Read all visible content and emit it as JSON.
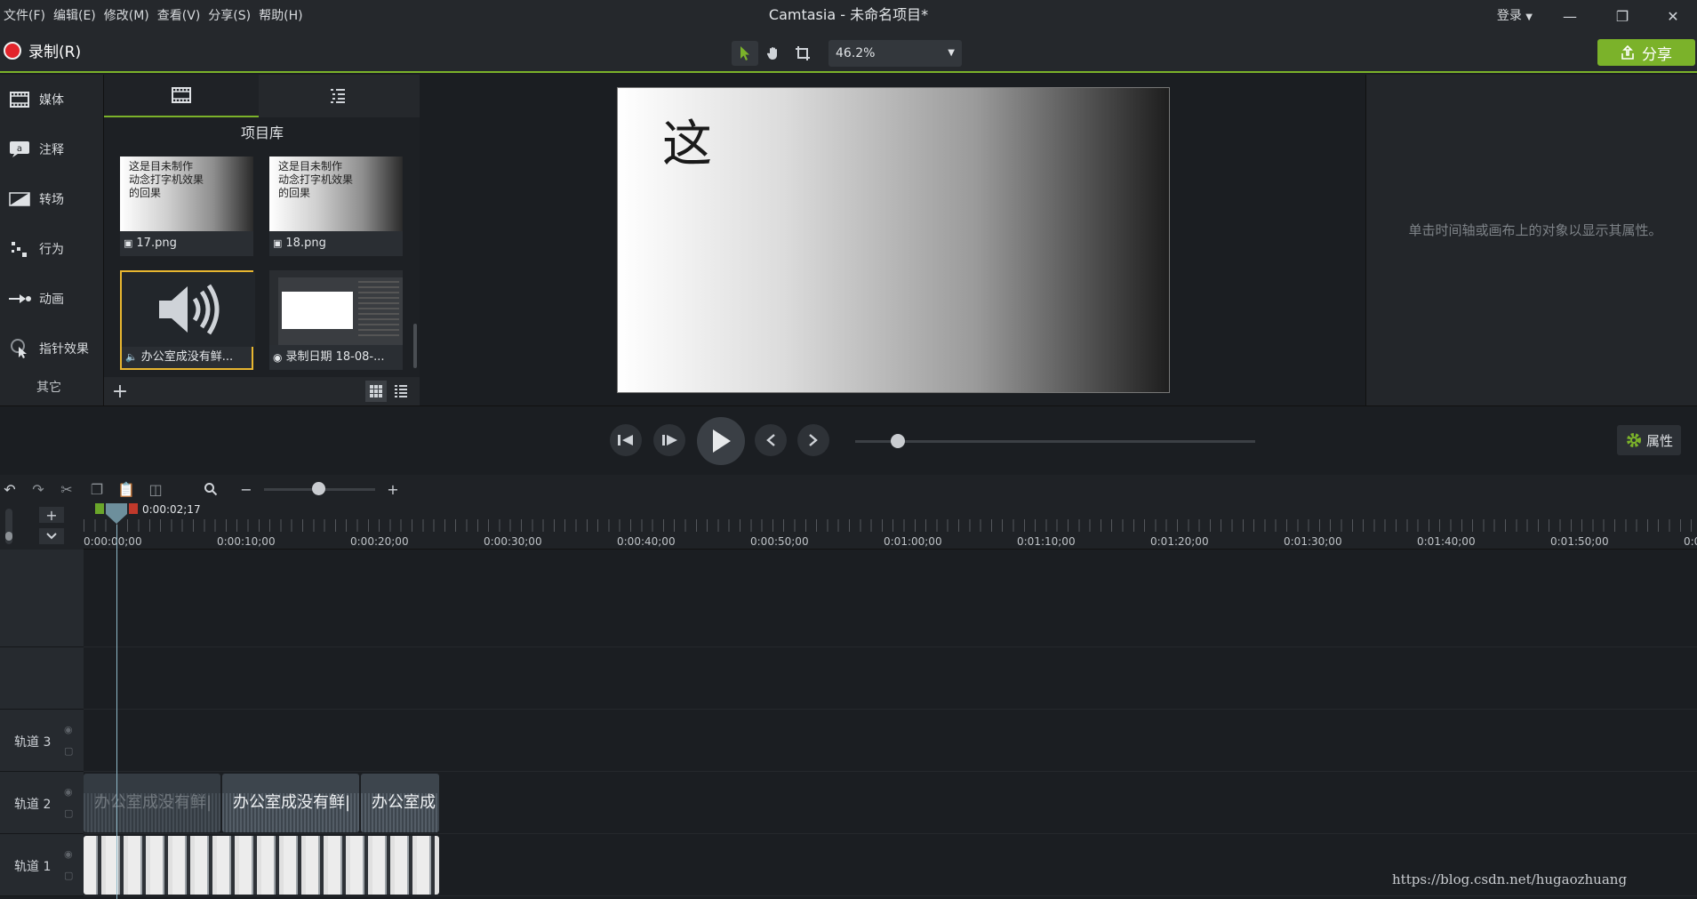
{
  "window": {
    "title": "Camtasia - 未命名项目*",
    "login": "登录",
    "minimize": "—",
    "restore": "❐",
    "close": "✕"
  },
  "menu": [
    "文件(F)",
    "编辑(E)",
    "修改(M)",
    "查看(V)",
    "分享(S)",
    "帮助(H)"
  ],
  "toolbar": {
    "record_label": "录制(R)",
    "zoom_value": "46.2%",
    "share_label": "分享",
    "accent": "#7bb22a",
    "record_color": "#e3242b"
  },
  "tools": [
    "媒体",
    "注释",
    "转场",
    "行为",
    "动画",
    "指针效果"
  ],
  "tools_other": "其它",
  "media": {
    "library_title": "项目库",
    "items": [
      {
        "name": "17.png",
        "kind": "image",
        "preview_text": [
          "这是目未制作",
          "动念打字机效果",
          "的回果"
        ]
      },
      {
        "name": "18.png",
        "kind": "image",
        "preview_text": [
          "这是目未制作",
          "动念打字机效果",
          "的回果"
        ]
      },
      {
        "name": "办公室成没有鲜...",
        "kind": "audio"
      },
      {
        "name": "录制日期 18-08-...",
        "kind": "recording"
      }
    ]
  },
  "canvas": {
    "text": "这"
  },
  "properties": {
    "hint": "单击时间轴或画布上的对象以显示其属性。",
    "button_label": "属性"
  },
  "timeline": {
    "playhead_time": "0:00:02;17",
    "zoom_minus": "−",
    "zoom_plus": "+",
    "ticks": [
      "0:00:00;00",
      "0:00:10;00",
      "0:00:20;00",
      "0:00:30;00",
      "0:00:40;00",
      "0:00:50;00",
      "0:01:00;00",
      "0:01:10;00",
      "0:01:20;00",
      "0:01:30;00",
      "0:01:40;00",
      "0:01:50;00",
      "0:0"
    ],
    "tracks": [
      {
        "name": "轨道 3"
      },
      {
        "name": "轨道 2"
      },
      {
        "name": "轨道 1"
      }
    ],
    "audio_clips": [
      "办公室成没有鲜|",
      "办公室成没有鲜|",
      "办公室成"
    ]
  },
  "watermark": "https://blog.csdn.net/hugaozhuang"
}
